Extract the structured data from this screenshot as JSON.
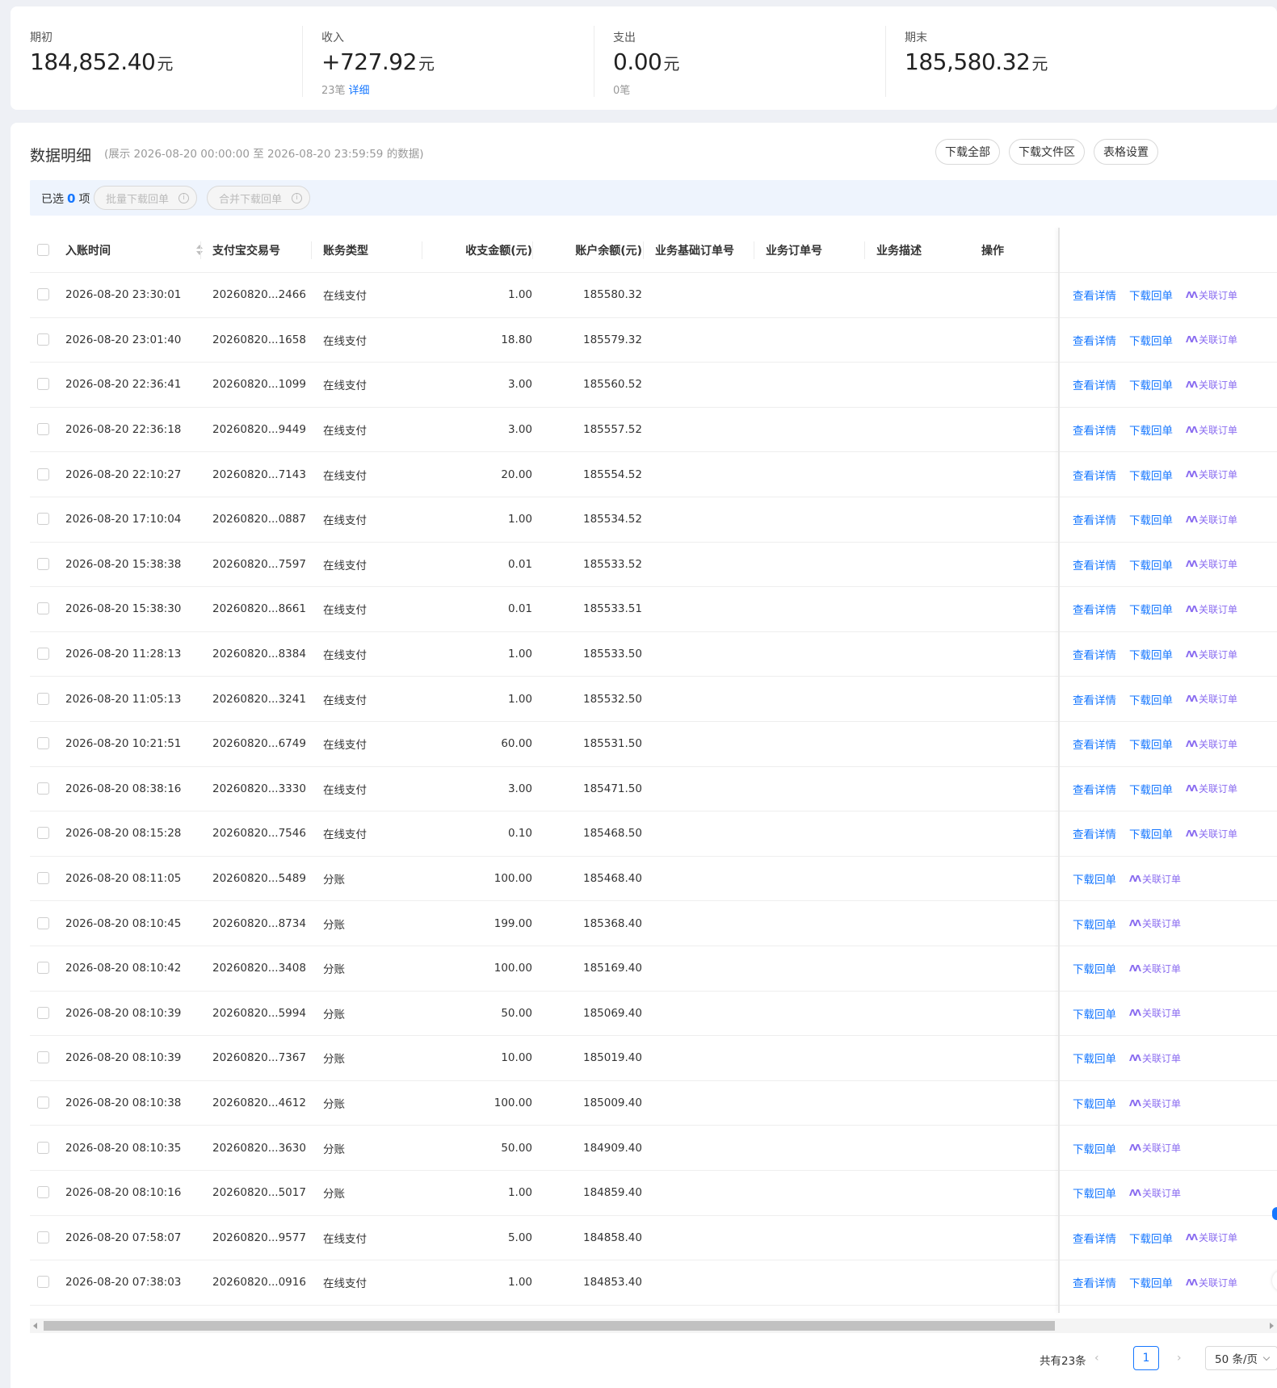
{
  "summary": [
    {
      "label": "期初",
      "value": "184,852.40",
      "unit": "元",
      "sub": "",
      "link": ""
    },
    {
      "label": "收入",
      "value": "+727.92",
      "unit": "元",
      "sub": "23笔",
      "link": "详细"
    },
    {
      "label": "支出",
      "value": "0.00",
      "unit": "元",
      "sub": "0笔",
      "link": ""
    },
    {
      "label": "期末",
      "value": "185,580.32",
      "unit": "元",
      "sub": "",
      "link": ""
    }
  ],
  "section": {
    "title": "数据明细",
    "range": "(展示 2026-08-20 00:00:00 至 2026-08-20 23:59:59 的数据)",
    "buttons": [
      "下载全部",
      "下载文件区",
      "表格设置"
    ]
  },
  "selection": {
    "prefix": "已选",
    "count": "0",
    "suffix": "项",
    "batch_download": "批量下载回单",
    "merge_download": "合并下载回单"
  },
  "table": {
    "headers": [
      "入账时间",
      "支付宝交易号",
      "账务类型",
      "收支金额(元)",
      "账户余额(元)",
      "业务基础订单号",
      "业务订单号",
      "业务描述",
      "操作"
    ],
    "actions": {
      "detail": "查看详情",
      "download": "下载回单",
      "relate": "关联订单"
    },
    "rows": [
      {
        "time": "2026-08-20 23:30:01",
        "trade": "20260820...2466",
        "type": "在线支付",
        "amount": "1.00",
        "balance": "185580.32"
      },
      {
        "time": "2026-08-20 23:01:40",
        "trade": "20260820...1658",
        "type": "在线支付",
        "amount": "18.80",
        "balance": "185579.32"
      },
      {
        "time": "2026-08-20 22:36:41",
        "trade": "20260820...1099",
        "type": "在线支付",
        "amount": "3.00",
        "balance": "185560.52"
      },
      {
        "time": "2026-08-20 22:36:18",
        "trade": "20260820...9449",
        "type": "在线支付",
        "amount": "3.00",
        "balance": "185557.52"
      },
      {
        "time": "2026-08-20 22:10:27",
        "trade": "20260820...7143",
        "type": "在线支付",
        "amount": "20.00",
        "balance": "185554.52"
      },
      {
        "time": "2026-08-20 17:10:04",
        "trade": "20260820...0887",
        "type": "在线支付",
        "amount": "1.00",
        "balance": "185534.52"
      },
      {
        "time": "2026-08-20 15:38:38",
        "trade": "20260820...7597",
        "type": "在线支付",
        "amount": "0.01",
        "balance": "185533.52"
      },
      {
        "time": "2026-08-20 15:38:30",
        "trade": "20260820...8661",
        "type": "在线支付",
        "amount": "0.01",
        "balance": "185533.51"
      },
      {
        "time": "2026-08-20 11:28:13",
        "trade": "20260820...8384",
        "type": "在线支付",
        "amount": "1.00",
        "balance": "185533.50"
      },
      {
        "time": "2026-08-20 11:05:13",
        "trade": "20260820...3241",
        "type": "在线支付",
        "amount": "1.00",
        "balance": "185532.50"
      },
      {
        "time": "2026-08-20 10:21:51",
        "trade": "20260820...6749",
        "type": "在线支付",
        "amount": "60.00",
        "balance": "185531.50"
      },
      {
        "time": "2026-08-20 08:38:16",
        "trade": "20260820...3330",
        "type": "在线支付",
        "amount": "3.00",
        "balance": "185471.50"
      },
      {
        "time": "2026-08-20 08:15:28",
        "trade": "20260820...7546",
        "type": "在线支付",
        "amount": "0.10",
        "balance": "185468.50"
      },
      {
        "time": "2026-08-20 08:11:05",
        "trade": "20260820...5489",
        "type": "分账",
        "amount": "100.00",
        "balance": "185468.40"
      },
      {
        "time": "2026-08-20 08:10:45",
        "trade": "20260820...8734",
        "type": "分账",
        "amount": "199.00",
        "balance": "185368.40"
      },
      {
        "time": "2026-08-20 08:10:42",
        "trade": "20260820...3408",
        "type": "分账",
        "amount": "100.00",
        "balance": "185169.40"
      },
      {
        "time": "2026-08-20 08:10:39",
        "trade": "20260820...5994",
        "type": "分账",
        "amount": "50.00",
        "balance": "185069.40"
      },
      {
        "time": "2026-08-20 08:10:39",
        "trade": "20260820...7367",
        "type": "分账",
        "amount": "10.00",
        "balance": "185019.40"
      },
      {
        "time": "2026-08-20 08:10:38",
        "trade": "20260820...4612",
        "type": "分账",
        "amount": "100.00",
        "balance": "185009.40"
      },
      {
        "time": "2026-08-20 08:10:35",
        "trade": "20260820...3630",
        "type": "分账",
        "amount": "50.00",
        "balance": "184909.40"
      },
      {
        "time": "2026-08-20 08:10:16",
        "trade": "20260820...5017",
        "type": "分账",
        "amount": "1.00",
        "balance": "184859.40"
      },
      {
        "time": "2026-08-20 07:58:07",
        "trade": "20260820...9577",
        "type": "在线支付",
        "amount": "5.00",
        "balance": "184858.40"
      },
      {
        "time": "2026-08-20 07:38:03",
        "trade": "20260820...0916",
        "type": "在线支付",
        "amount": "1.00",
        "balance": "184853.40"
      }
    ]
  },
  "pagination": {
    "total": "共有23条",
    "current": "1",
    "page_size": "50 条/页"
  },
  "colors": {
    "primary": "#1677ff",
    "relate": "#8a6cf0"
  }
}
